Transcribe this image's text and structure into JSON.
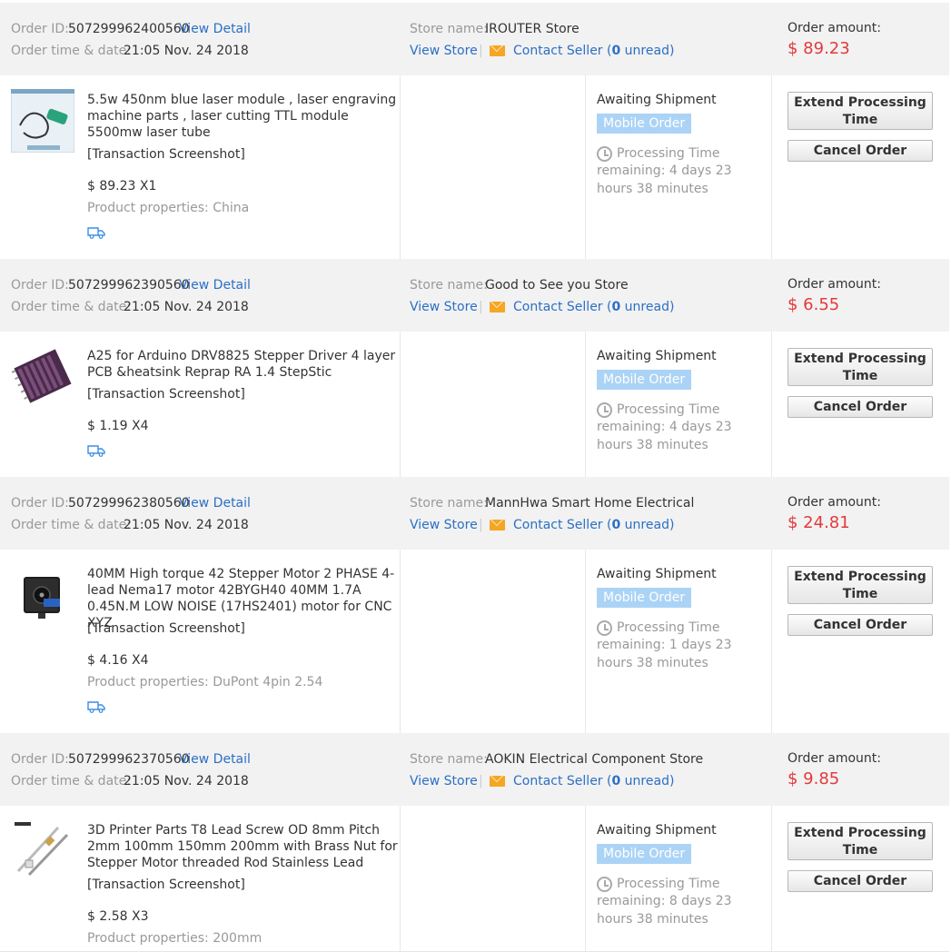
{
  "labels": {
    "order_id": "Order ID:",
    "view_detail": "View Detail",
    "order_time": "Order time & date:",
    "store_name": "Store name:",
    "view_store": "View Store",
    "separator": "|",
    "contact_seller": "Contact Seller (",
    "unread_suffix": " unread)",
    "order_amount": "Order amount:",
    "transaction_screenshot": "[Transaction Screenshot]",
    "status": "Awaiting Shipment",
    "mobile_order": "Mobile Order",
    "processing_time": "Processing Time",
    "extend_processing": "Extend Processing Time",
    "cancel_order": "Cancel Order"
  },
  "orders": [
    {
      "order_id": "507299962400560",
      "datetime": "21:05 Nov. 24 2018",
      "store": "IROUTER Store",
      "unread": "0",
      "amount": "$ 89.23",
      "title": "5.5w 450nm blue laser module , laser engraving machine parts , laser cutting TTL module 5500mw laser tube",
      "price_qty": "$ 89.23 X1",
      "properties": "Product properties: China",
      "remaining": "remaining: 4 days 23 hours 38 minutes"
    },
    {
      "order_id": "507299962390560",
      "datetime": "21:05 Nov. 24 2018",
      "store": "Good to See you Store",
      "unread": "0",
      "amount": "$ 6.55",
      "title": "A25 for Arduino DRV8825 Stepper Driver 4 layer PCB &heatsink Reprap RA 1.4 StepStic",
      "price_qty": "$ 1.19 X4",
      "properties": "",
      "remaining": "remaining: 4 days 23 hours 38 minutes"
    },
    {
      "order_id": "507299962380560",
      "datetime": "21:05 Nov. 24 2018",
      "store": "MannHwa Smart Home Electrical",
      "unread": "0",
      "amount": "$ 24.81",
      "title": "40MM High torque 42 Stepper Motor 2 PHASE 4-lead Nema17 motor 42BYGH40 40MM 1.7A 0.45N.M LOW NOISE (17HS2401) motor for CNC XYZ",
      "price_qty": "$ 4.16 X4",
      "properties": "Product properties: DuPont 4pin 2.54",
      "remaining": "remaining: 1 days 23 hours 38 minutes"
    },
    {
      "order_id": "507299962370560",
      "datetime": "21:05 Nov. 24 2018",
      "store": "AOKIN Electrical Component Store",
      "unread": "0",
      "amount": "$ 9.85",
      "title": "3D Printer Parts T8 Lead Screw OD 8mm Pitch 2mm 100mm 150mm 200mm with Brass Nut for Stepper Motor threaded Rod Stainless Lead",
      "price_qty": "$ 2.58 X3",
      "properties": "Product properties: 200mm",
      "remaining": "remaining: 8 days 23 hours 38 minutes"
    }
  ]
}
